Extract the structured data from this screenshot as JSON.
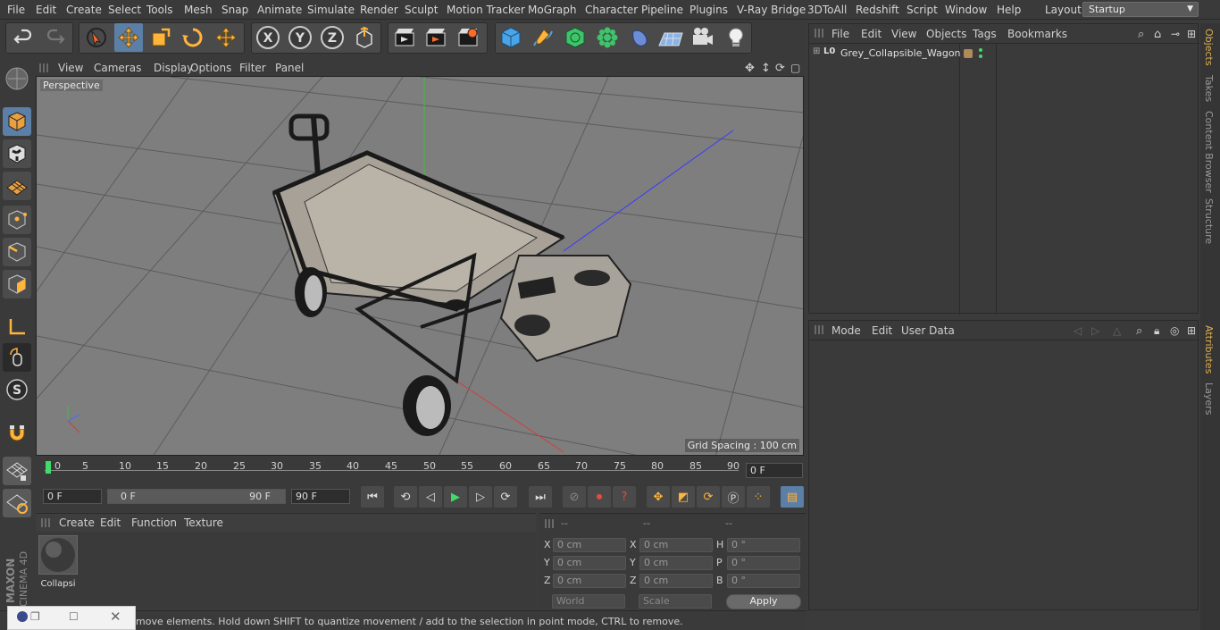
{
  "menubar": {
    "items": [
      "File",
      "Edit",
      "Create",
      "Select",
      "Tools",
      "Mesh",
      "Snap",
      "Animate",
      "Simulate",
      "Render",
      "Sculpt",
      "Motion Tracker",
      "MoGraph",
      "Character",
      "Pipeline",
      "Plugins",
      "V-Ray Bridge",
      "3DToAll",
      "Redshift",
      "Script",
      "Window",
      "Help"
    ],
    "layout_label": "Layout:",
    "layout_value": "Startup"
  },
  "viewport": {
    "menu": [
      "View",
      "Cameras",
      "Display",
      "Options",
      "Filter",
      "Panel"
    ],
    "label": "Perspective",
    "grid_spacing": "Grid Spacing : 100 cm"
  },
  "timeline": {
    "ticks": [
      "0",
      "5",
      "10",
      "15",
      "20",
      "25",
      "30",
      "35",
      "40",
      "45",
      "50",
      "55",
      "60",
      "65",
      "70",
      "75",
      "80",
      "85",
      "90"
    ],
    "current_frame": "0 F"
  },
  "transport": {
    "start_field": "0 F",
    "range_start": "0 F",
    "range_end": "90 F",
    "end_field": "90 F"
  },
  "materials": {
    "menu": [
      "Create",
      "Edit",
      "Function",
      "Texture"
    ],
    "items": [
      {
        "name": "Collapsi"
      }
    ]
  },
  "coords": {
    "headers": [
      "--",
      "--",
      "--"
    ],
    "pos": {
      "x": "0 cm",
      "y": "0 cm",
      "z": "0 cm"
    },
    "size": {
      "x": "0 cm",
      "y": "0 cm",
      "z": "0 cm"
    },
    "rot": {
      "h": "0 °",
      "p": "0 °",
      "b": "0 °"
    },
    "labels": {
      "x": "X",
      "y": "Y",
      "z": "Z",
      "h": "H",
      "p": "P",
      "b": "B"
    },
    "mode_world": "World",
    "mode_scale": "Scale",
    "apply": "Apply"
  },
  "objects_panel": {
    "menu": [
      "File",
      "Edit",
      "View",
      "Objects",
      "Tags",
      "Bookmarks"
    ],
    "items": [
      {
        "name": "Grey_Collapsible_Wagon"
      }
    ]
  },
  "attributes_panel": {
    "menu": [
      "Mode",
      "Edit",
      "User Data"
    ]
  },
  "right_tabs": [
    "Objects",
    "Takes",
    "Content Browser",
    "Structure",
    "Attributes",
    "Layers"
  ],
  "status": {
    "text": "move elements. Hold down SHIFT to quantize movement / add to the selection in point mode, CTRL to remove."
  },
  "branding": {
    "maxon": "MAXON",
    "product": "CINEMA 4D"
  },
  "colors": {
    "accent_blue": "#5b7fa6",
    "active_tab": "#e0b050"
  }
}
